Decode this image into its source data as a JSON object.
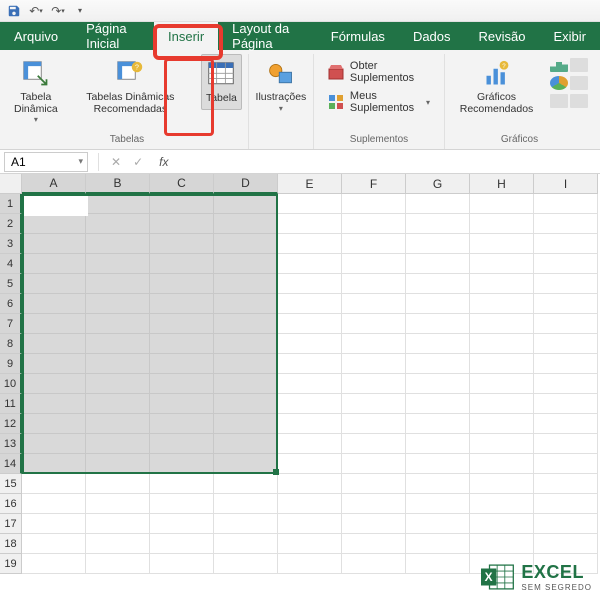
{
  "qat": {
    "save": "save",
    "undo": "undo",
    "redo": "redo"
  },
  "tabs": {
    "arquivo": "Arquivo",
    "pagina_inicial": "Página Inicial",
    "inserir": "Inserir",
    "layout": "Layout da Página",
    "formulas": "Fórmulas",
    "dados": "Dados",
    "revisao": "Revisão",
    "exibir": "Exibir"
  },
  "ribbon": {
    "tabelas": {
      "tabela_dinamica": "Tabela Dinâmica",
      "tabelas_dinamicas_recomendadas": "Tabelas Dinâmicas Recomendadas",
      "tabela": "Tabela",
      "group_label": "Tabelas"
    },
    "ilustracoes": {
      "label": "Ilustrações"
    },
    "suplementos": {
      "obter": "Obter Suplementos",
      "meus": "Meus Suplementos",
      "group_label": "Suplementos"
    },
    "graficos": {
      "recomendados": "Gráficos Recomendados",
      "group_label": "Gráficos"
    }
  },
  "namebox": "A1",
  "fx_label": "fx",
  "columns": [
    "A",
    "B",
    "C",
    "D",
    "E",
    "F",
    "G",
    "H",
    "I"
  ],
  "rows": [
    "1",
    "2",
    "3",
    "4",
    "5",
    "6",
    "7",
    "8",
    "9",
    "10",
    "11",
    "12",
    "13",
    "14",
    "15",
    "16",
    "17",
    "18",
    "19"
  ],
  "selected_cols": 4,
  "selected_rows": 14,
  "logo": {
    "brand": "EXCEL",
    "tag": "SEM SEGREDO"
  }
}
